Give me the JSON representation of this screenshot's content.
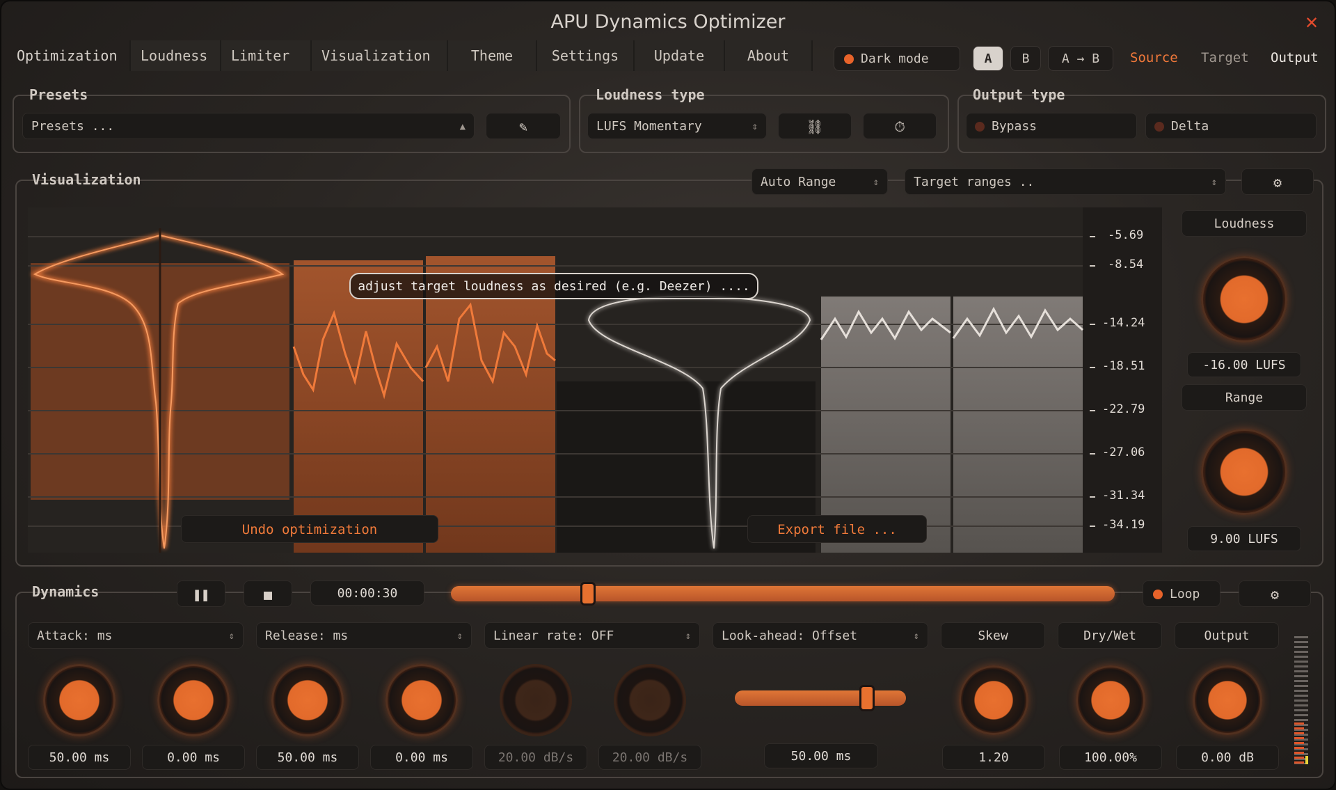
{
  "window": {
    "title": "APU Dynamics Optimizer"
  },
  "tabs": [
    "Optimization",
    "Loudness",
    "Limiter",
    "Visualization",
    "Theme",
    "Settings",
    "Update",
    "About"
  ],
  "header": {
    "dark_mode": "Dark mode",
    "a": "A",
    "b": "B",
    "ab": "A → B",
    "source": "Source",
    "target": "Target",
    "output": "Output"
  },
  "presets": {
    "label": "Presets",
    "value": "Presets ..."
  },
  "loudness_type": {
    "label": "Loudness type",
    "value": "LUFS Momentary"
  },
  "output_type": {
    "label": "Output type",
    "bypass": "Bypass",
    "delta": "Delta"
  },
  "visualization": {
    "label": "Visualization",
    "range_mode": "Auto Range",
    "target_ranges": "Target ranges ..",
    "overlay": "adjust target loudness as desired (e.g. Deezer) ....",
    "undo": "Undo optimization",
    "export": "Export file ...",
    "scale": [
      "-5.69",
      "-8.54",
      "-14.24",
      "-18.51",
      "-22.79",
      "-27.06",
      "-31.34",
      "-34.19"
    ]
  },
  "right_panel": {
    "loudness_label": "Loudness",
    "loudness_value": "-16.00 LUFS",
    "range_label": "Range",
    "range_value": "9.00 LUFS"
  },
  "dynamics": {
    "label": "Dynamics",
    "time": "00:00:30",
    "loop": "Loop",
    "progress": 0.2,
    "attack": "Attack: ms",
    "release": "Release: ms",
    "linear_rate": "Linear rate: OFF",
    "lookahead": "Look-ahead: Offset",
    "skew": "Skew",
    "drywet": "Dry/Wet",
    "output": "Output",
    "values": [
      "50.00 ms",
      "0.00 ms",
      "50.00 ms",
      "0.00 ms",
      "20.00 dB/s",
      "20.00 dB/s"
    ],
    "lookahead_value": "50.00 ms",
    "lookahead_level": 0.8,
    "skew_value": "1.20",
    "drywet_value": "100.00%",
    "output_value": "0.00 dB"
  }
}
